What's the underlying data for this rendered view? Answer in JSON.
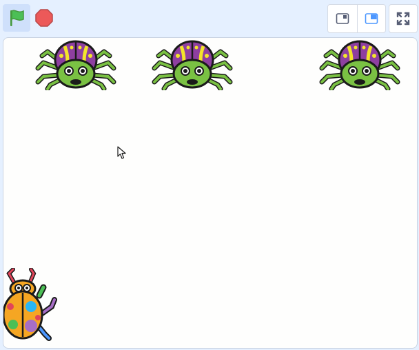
{
  "toolbar": {
    "green_flag_icon": "green-flag-icon",
    "stop_icon": "stop-sign-icon",
    "layout_small_icon": "small-stage-icon",
    "layout_large_icon": "large-stage-icon",
    "fullscreen_icon": "fullscreen-icon"
  },
  "stage": {
    "sprites": [
      {
        "name": "spider",
        "icon": "spider-icon"
      },
      {
        "name": "spider",
        "icon": "spider-icon"
      },
      {
        "name": "spider",
        "icon": "spider-icon"
      },
      {
        "name": "beetle",
        "icon": "beetle-icon"
      }
    ]
  },
  "colors": {
    "toolbar_bg": "#e5f0ff",
    "flag_green": "#4cbf56",
    "stop_red": "#ec5959",
    "accent_blue": "#4c97ff",
    "stage_bg": "#fefefd"
  }
}
